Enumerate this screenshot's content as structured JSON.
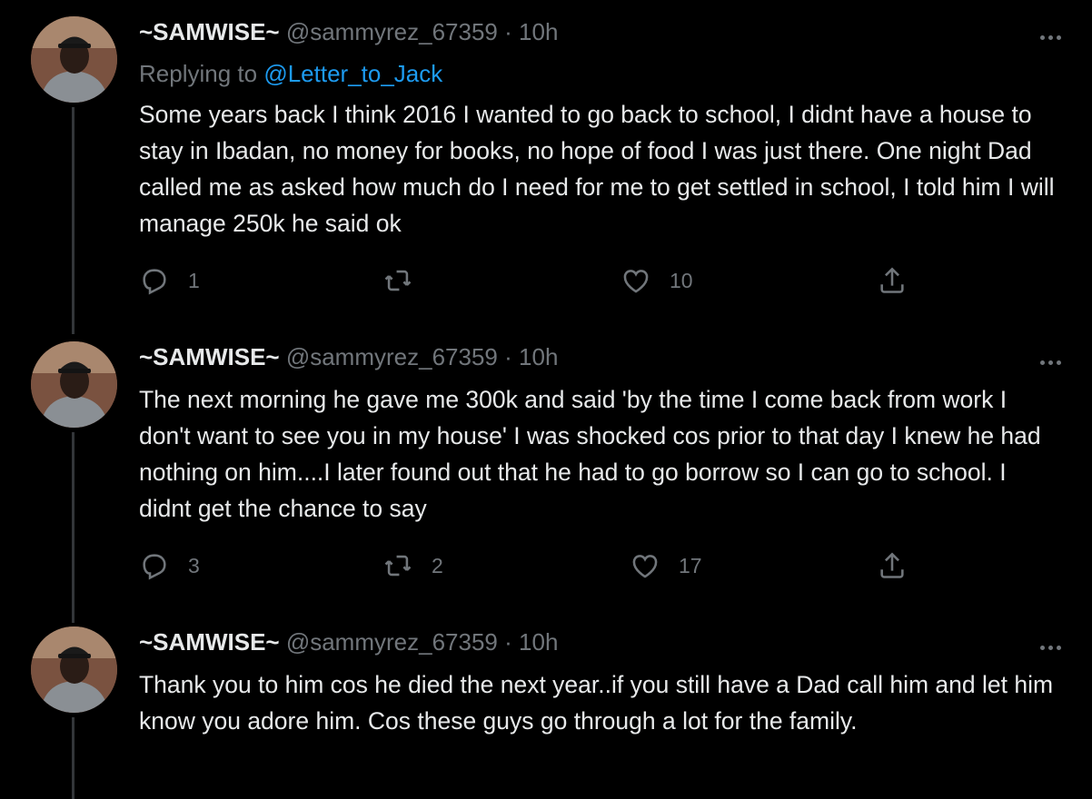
{
  "tweets": [
    {
      "name": "~SAMWISE~",
      "handle": "@sammyrez_67359",
      "dot": "·",
      "time": "10h",
      "replying_prefix": "Replying to ",
      "replying_to": "@Letter_to_Jack",
      "text": "Some years back I think 2016 I wanted to go back to school, I didnt have a house to stay in Ibadan, no money for books, no hope of food I was just there. One night Dad called me as asked how much do I need for me to get settled in school, I told him I will manage 250k he said ok",
      "replies": "1",
      "retweets": "",
      "likes": "10"
    },
    {
      "name": "~SAMWISE~",
      "handle": "@sammyrez_67359",
      "dot": "·",
      "time": "10h",
      "text": "The next morning he gave me 300k and said 'by the time I come back from work I don't want to see you in my house' I was shocked cos prior to that day I knew he had nothing on him....I later found out that he had to go borrow so I can go to school. I didnt get the chance to say",
      "replies": "3",
      "retweets": "2",
      "likes": "17"
    },
    {
      "name": "~SAMWISE~",
      "handle": "@sammyrez_67359",
      "dot": "·",
      "time": "10h",
      "text": "Thank you to him cos he died the next year..if you still have a Dad call him and let him know you adore him. Cos these guys go through a lot for the family."
    }
  ],
  "icons": {
    "reply": "reply-icon",
    "retweet": "retweet-icon",
    "like": "heart-icon",
    "share": "share-icon",
    "more": "more-icon"
  },
  "colors": {
    "background": "#000000",
    "text": "#e7e9ea",
    "secondary": "#71767b",
    "link": "#1d9bf0",
    "thread_line": "#333639"
  }
}
